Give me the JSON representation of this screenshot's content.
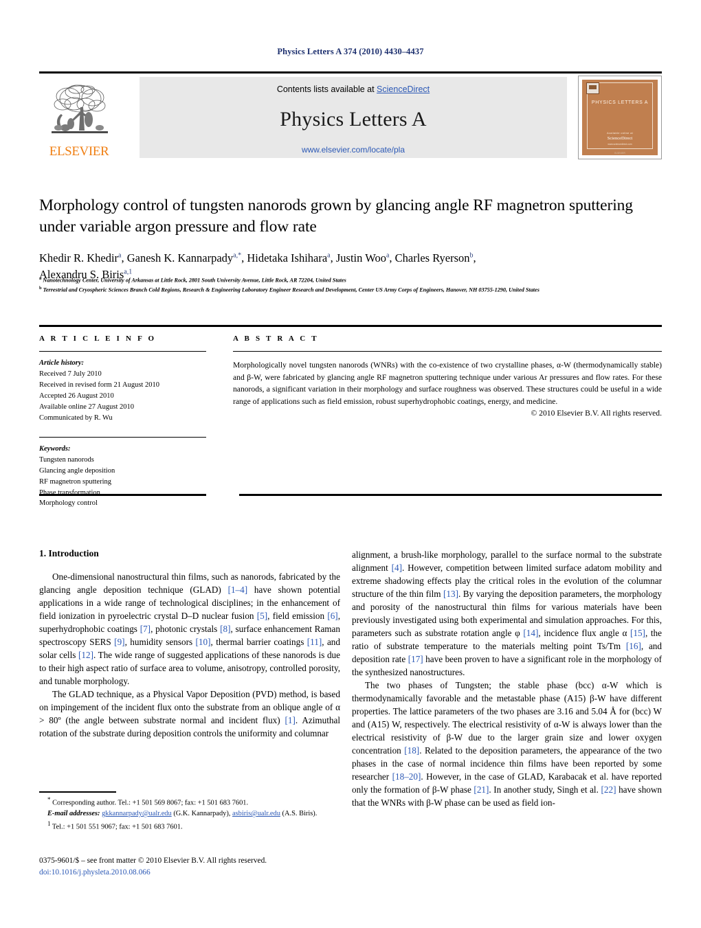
{
  "running_head": "Physics Letters A 374 (2010) 4430–4437",
  "banner": {
    "publisher_name": "ELSEVIER",
    "contents_prefix": "Contents lists available at ",
    "sciencedirect": "ScienceDirect",
    "journal_title": "Physics Letters A",
    "journal_url": "www.elsevier.com/locate/pla",
    "cover": {
      "title": "PHYSICS LETTERS A",
      "foot1": "Available online at",
      "foot2": "ScienceDirect",
      "foot3": "www.sciencedirect.com",
      "foot4": "ELSEVIER"
    }
  },
  "article": {
    "title": "Morphology control of tungsten nanorods grown by glancing angle RF magnetron sputtering under variable argon pressure and flow rate",
    "authors": [
      {
        "name": "Khedir R. Khedir",
        "marks": "a"
      },
      {
        "name": "Ganesh K. Kannarpady",
        "marks": "a,*"
      },
      {
        "name": "Hidetaka Ishihara",
        "marks": "a"
      },
      {
        "name": "Justin Woo",
        "marks": "a"
      },
      {
        "name": "Charles Ryerson",
        "marks": "b"
      },
      {
        "name": "Alexandru S. Biris",
        "marks": "a,1"
      }
    ],
    "affiliations": [
      {
        "mark": "a",
        "text": "Nanotechnology Center, University of Arkansas at Little Rock, 2801 South University Avenue, Little Rock, AR 72204, United States"
      },
      {
        "mark": "b",
        "text": "Terrestrial and Cryospheric Sciences Branch Cold Regions, Research & Engineering Laboratory Engineer Research and Development, Center US Army Corps of Engineers, Hanover, NH 03755-1290, United States"
      }
    ]
  },
  "article_info": {
    "heading": "A R T I C L E   I N F O",
    "history_label": "Article history:",
    "history": [
      "Received 7 July 2010",
      "Received in revised form 21 August 2010",
      "Accepted 26 August 2010",
      "Available online 27 August 2010",
      "Communicated by R. Wu"
    ],
    "keywords_label": "Keywords:",
    "keywords": [
      "Tungsten nanorods",
      "Glancing angle deposition",
      "RF magnetron sputtering",
      "Phase transformation",
      "Morphology control"
    ]
  },
  "abstract": {
    "heading": "A B S T R A C T",
    "text": "Morphologically novel tungsten nanorods (WNRs) with the co-existence of two crystalline phases, α-W (thermodynamically stable) and β-W, were fabricated by glancing angle RF magnetron sputtering technique under various Ar pressures and flow rates. For these nanorods, a significant variation in their morphology and surface roughness was observed. These structures could be useful in a wide range of applications such as field emission, robust superhydrophobic coatings, energy, and medicine.",
    "copyright": "© 2010 Elsevier B.V. All rights reserved."
  },
  "body": {
    "section_title": "1. Introduction",
    "left_paragraphs": [
      "One-dimensional nanostructural thin films, such as nanorods, fabricated by the glancing angle deposition technique (GLAD) [1–4] have shown potential applications in a wide range of technological disciplines; in the enhancement of field ionization in pyroelectric crystal D–D nuclear fusion [5], field emission [6], superhydrophobic coatings [7], photonic crystals [8], surface enhancement Raman spectroscopy SERS [9], humidity sensors [10], thermal barrier coatings [11], and solar cells [12]. The wide range of suggested applications of these nanorods is due to their high aspect ratio of surface area to volume, anisotropy, controlled porosity, and tunable morphology.",
      "The GLAD technique, as a Physical Vapor Deposition (PVD) method, is based on impingement of the incident flux onto the substrate from an oblique angle of α > 80º (the angle between substrate normal and incident flux) [1]. Azimuthal rotation of the substrate during deposition controls the uniformity and columnar"
    ],
    "right_paragraphs": [
      "alignment, a brush-like morphology, parallel to the surface normal to the substrate alignment [4]. However, competition between limited surface adatom mobility and extreme shadowing effects play the critical roles in the evolution of the columnar structure of the thin film [13]. By varying the deposition parameters, the morphology and porosity of the nanostructural thin films for various materials have been previously investigated using both experimental and simulation approaches. For this, parameters such as substrate rotation angle φ [14], incidence flux angle α [15], the ratio of substrate temperature to the materials melting point Ts/Tm [16], and deposition rate [17] have been proven to have a significant role in the morphology of the synthesized nanostructures.",
      "The two phases of Tungsten; the stable phase (bcc) α-W which is thermodynamically favorable and the metastable phase (A15) β-W have different properties. The lattice parameters of the two phases are 3.16 and 5.04 Å for (bcc) W and (A15) W, respectively. The electrical resistivity of α-W is always lower than the electrical resistivity of β-W due to the larger grain size and lower oxygen concentration [18]. Related to the deposition parameters, the appearance of the two phases in the case of normal incidence thin films have been reported by some researcher [18–20]. However, in the case of GLAD, Karabacak et al. have reported only the formation of β-W phase [21]. In another study, Singh et al. [22] have shown that the WNRs with β-W phase can be used as field ion-"
    ]
  },
  "footnotes": {
    "corresponding": "Corresponding author. Tel.: +1 501 569 8067; fax: +1 501 683 7601.",
    "email_label": "E-mail addresses:",
    "email1": "gkkannarpady@ualr.edu",
    "email1_owner": "(G.K. Kannarpady),",
    "email2": "asbiris@ualr.edu",
    "email2_owner": "(A.S. Biris).",
    "note1": "Tel.: +1 501 551 9067; fax: +1 501 683 7601.",
    "issn_line": "0375-9601/$ – see front matter  © 2010 Elsevier B.V. All rights reserved.",
    "doi": "doi:10.1016/j.physleta.2010.08.066"
  },
  "colors": {
    "link": "#2b58b5",
    "elsevier_orange": "#f07f13",
    "running_head": "#1c2f6e",
    "cover_bg": "#c07f4f"
  }
}
